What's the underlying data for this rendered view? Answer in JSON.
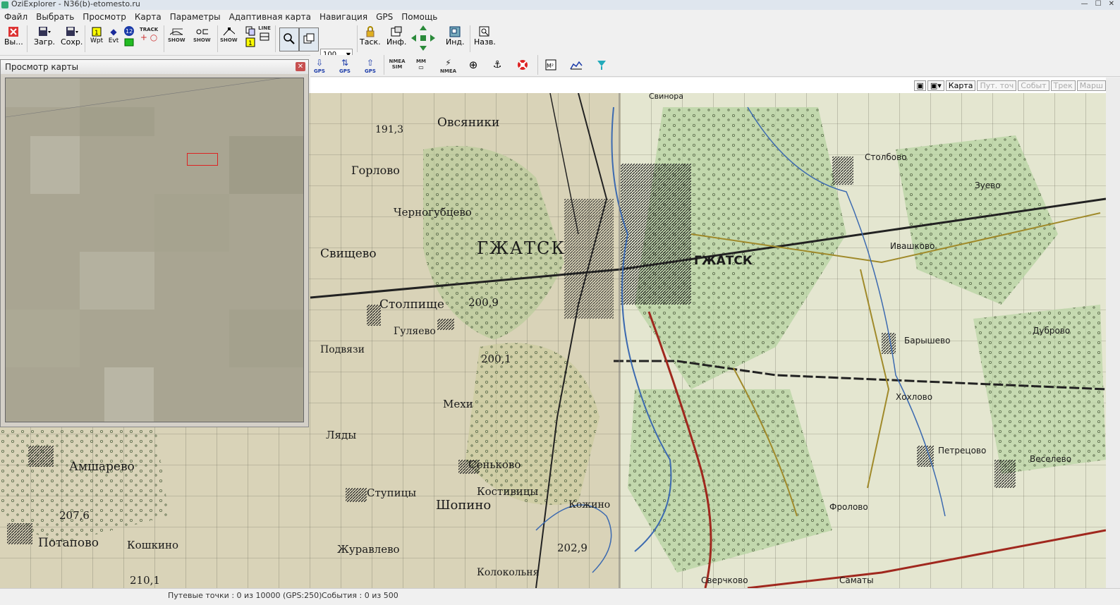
{
  "window": {
    "title": "OziExplorer - N36(b)-etomesto.ru"
  },
  "menu": [
    "Файл",
    "Выбрать",
    "Просмотр",
    "Карта",
    "Параметры",
    "Адаптивная карта",
    "Навигация",
    "GPS",
    "Помощь"
  ],
  "toolbar": {
    "exit_label": "Вы...",
    "load_label": "Загр.",
    "save_label": "Сохр.",
    "wpt_label": "Wpt",
    "evt_label": "Evt",
    "track_label": "TRACK",
    "show_label": "SHOW",
    "line_label": "LINE",
    "zoom_value": "100",
    "drag_label": "Таск.",
    "info_label": "Инф.",
    "index_label": "Инд.",
    "name_label": "Назв.",
    "gps_label": "GPS",
    "nmea_sim_label": "NMEA SIM",
    "mm_label": "MM",
    "nmea_label": "NMEA"
  },
  "map_tabs": [
    "Карта",
    "Пут. точ",
    "Событ",
    "Трек",
    "Марш"
  ],
  "map_labels": {
    "ovsyaniki": "Овсяники",
    "gorlovo": "Горлово",
    "chernogubtsevo": "Черногубцево",
    "gzhatsk_w": "ГЖАТСК",
    "gzhatsk_e": "ГЖАТСК",
    "svishchevo": "Свищево",
    "stolpishche": "Столпище",
    "gulyaevo": "Гуляево",
    "podyyazi": "Подвязи",
    "mekhi": "Мехи",
    "lyady": "Ляды",
    "amsharevo": "Амшарево",
    "potapovo": "Потапово",
    "koshkino": "Кошкино",
    "zhuravlevo": "Журавлево",
    "stupitsy": "Ступицы",
    "shopino": "Шопино",
    "senkovo": "Сеньково",
    "kostivitsy": "Костивицы",
    "kozhino": "Кожино",
    "kolokolnya": "Колокольня",
    "stolbovo": "Столбово",
    "zuevo": "Зуево",
    "ivashkovo": "Ивашково",
    "baryshevo": "Барышево",
    "dubrovo": "Дуброво",
    "khokhlovo": "Хохлово",
    "petretsovo": "Петрецово",
    "veselevo": "Веселево",
    "frolovo": "Фролово",
    "sverchkovo": "Сверчково",
    "samaty": "Саматы",
    "svinora": "Свинора",
    "h191": "191,3",
    "h2009": "200,9",
    "h2001": "200,1",
    "h2076": "207,6",
    "h2101": "210,1",
    "h2029": "202,9"
  },
  "preview": {
    "title": "Просмотр карты"
  },
  "status": {
    "waypoints": "Путевые точки : 0 из 10000  (GPS:250)",
    "events": "События : 0 из 500"
  },
  "colors": {
    "map_paper": "#d9d3b8",
    "forest": "#b9d4a4",
    "road": "#a0281e",
    "water": "#3c6ab0",
    "selection": "#dd2222"
  }
}
